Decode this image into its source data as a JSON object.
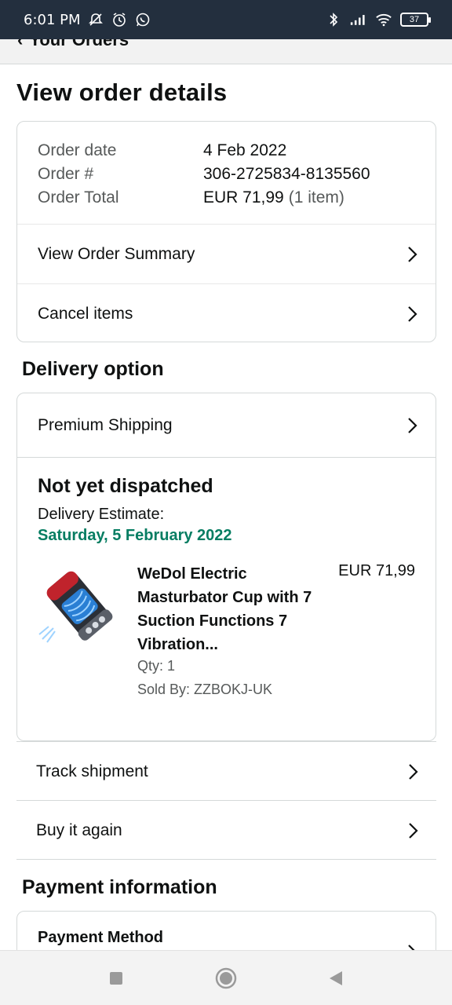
{
  "status_bar": {
    "time": "6:01 PM",
    "battery": "37",
    "icons_left": [
      "mute-icon",
      "alarm-icon",
      "whatsapp-icon"
    ],
    "icons_right": [
      "bluetooth-icon",
      "signal-icon",
      "wifi-icon",
      "battery-icon"
    ]
  },
  "nav": {
    "back_label": "Your Orders"
  },
  "page": {
    "title": "View order details"
  },
  "order": {
    "date_label": "Order date",
    "date_value": "4 Feb 2022",
    "number_label": "Order #",
    "number_value": "306-2725834-8135560",
    "total_label": "Order Total",
    "total_value": "EUR 71,99",
    "total_items": "(1 item)",
    "summary_label": "View Order Summary",
    "cancel_label": "Cancel items"
  },
  "delivery": {
    "section_title": "Delivery option",
    "option_label": "Premium Shipping",
    "status": "Not yet dispatched",
    "estimate_label": "Delivery Estimate:",
    "estimate_date": "Saturday, 5 February 2022",
    "accent_color": "#067d62"
  },
  "item": {
    "title": "WeDol Electric Masturbator Cup with 7 Suction Functions 7 Vibration...",
    "price": "EUR 71,99",
    "qty": "Qty: 1",
    "seller": "Sold By: ZZBOKJ-UK"
  },
  "actions": {
    "track_label": "Track shipment",
    "buy_again_label": "Buy it again"
  },
  "payment": {
    "section_title": "Payment information",
    "method_label": "Payment Method"
  },
  "system_nav": [
    "recents-icon",
    "home-icon",
    "back-icon"
  ]
}
